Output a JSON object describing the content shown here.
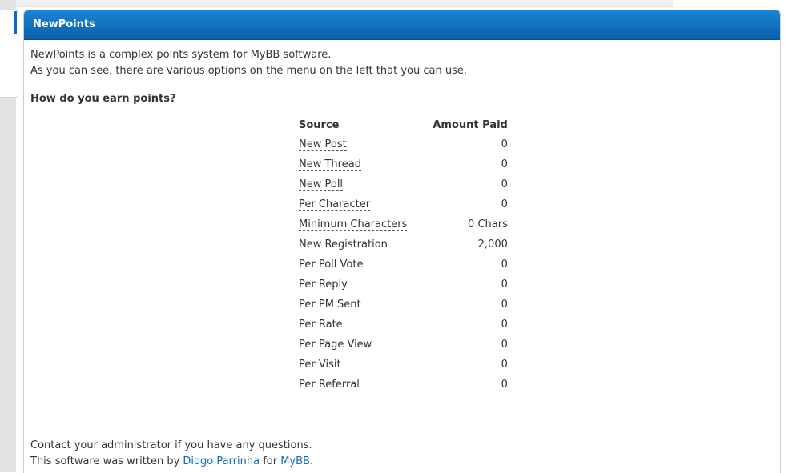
{
  "panel": {
    "title": "NewPoints"
  },
  "intro": {
    "line1": "NewPoints is a complex points system for MyBB software.",
    "line2": "As you can see, there are various options on the menu on the left that you can use."
  },
  "earn": {
    "heading": "How do you earn points?",
    "columns": {
      "source": "Source",
      "amount": "Amount Paid"
    },
    "rows": [
      {
        "source": "New Post",
        "amount": "0"
      },
      {
        "source": "New Thread",
        "amount": "0"
      },
      {
        "source": "New Poll",
        "amount": "0"
      },
      {
        "source": "Per Character",
        "amount": "0"
      },
      {
        "source": "Minimum Characters",
        "amount": "0 Chars"
      },
      {
        "source": "New Registration",
        "amount": "2,000"
      },
      {
        "source": "Per Poll Vote",
        "amount": "0"
      },
      {
        "source": "Per Reply",
        "amount": "0"
      },
      {
        "source": "Per PM Sent",
        "amount": "0"
      },
      {
        "source": "Per Rate",
        "amount": "0"
      },
      {
        "source": "Per Page View",
        "amount": "0"
      },
      {
        "source": "Per Visit",
        "amount": "0"
      },
      {
        "source": "Per Referral",
        "amount": "0"
      }
    ]
  },
  "footer": {
    "contact": "Contact your administrator if you have any questions.",
    "credit_prefix": "This software was written by ",
    "author": "Diogo Parrinha",
    "credit_middle": " for ",
    "platform": "MyBB",
    "credit_suffix": "."
  },
  "colors": {
    "header_top": "#1b86d6",
    "header_bottom": "#0b5ea8",
    "link": "#0f6ab9"
  }
}
